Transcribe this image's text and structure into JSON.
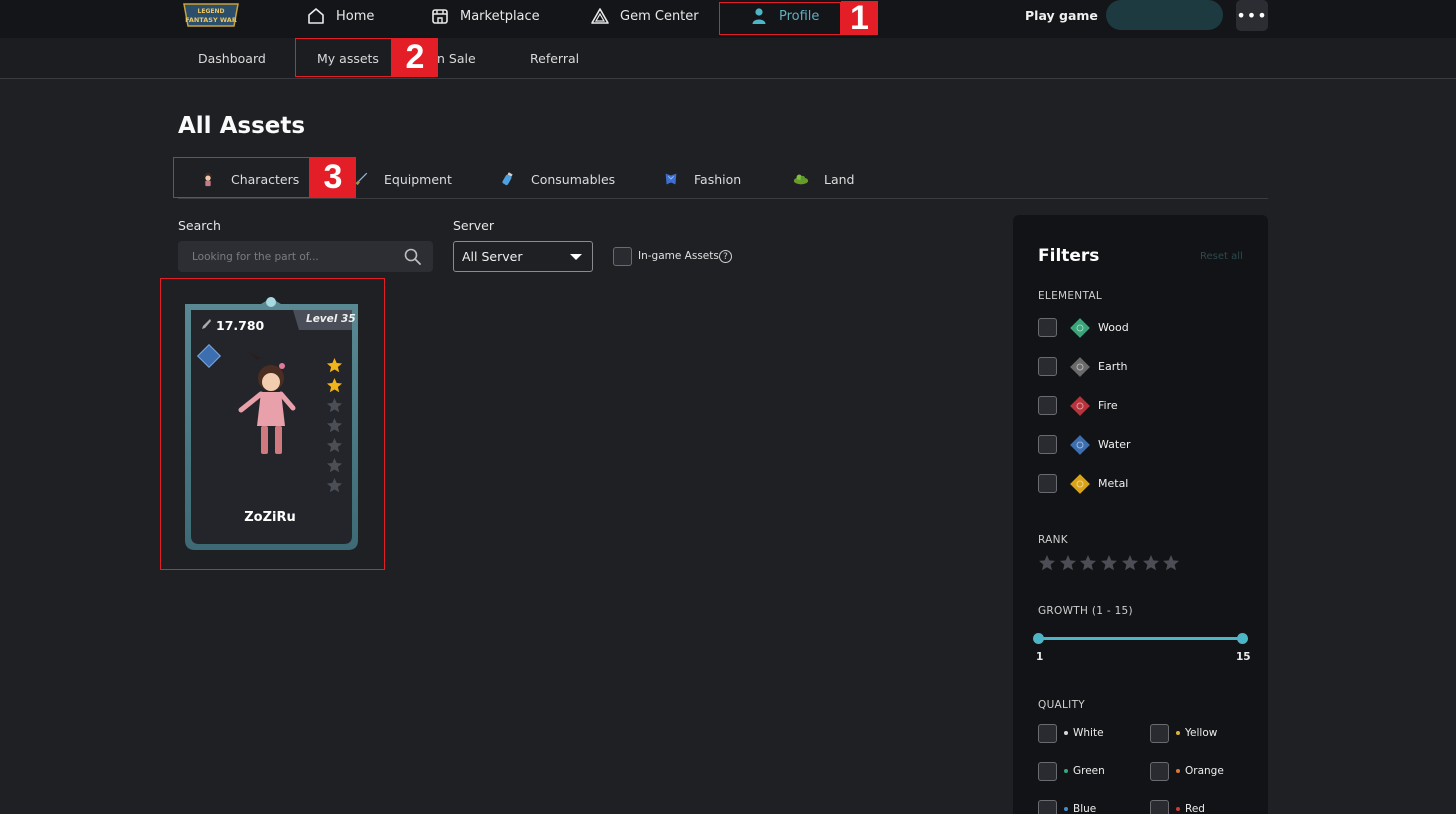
{
  "nav": {
    "logo_text_top": "LEGEND",
    "logo_text_bottom": "FANTASY WAR",
    "home": "Home",
    "marketplace": "Marketplace",
    "gem_center": "Gem Center",
    "profile": "Profile",
    "play_game": "Play game",
    "more": "•••"
  },
  "subnav": {
    "dashboard": "Dashboard",
    "my_assets": "My assets",
    "on_sale": "n Sale",
    "referral": "Referral"
  },
  "annotations": [
    "1",
    "2",
    "3"
  ],
  "page": {
    "title": "All Assets"
  },
  "tabs": [
    "Characters",
    "Equipment",
    "Consumables",
    "Fashion",
    "Land"
  ],
  "search": {
    "label": "Search",
    "placeholder": "Looking for the part of..."
  },
  "server": {
    "label": "Server",
    "selected": "All Server"
  },
  "ingame": {
    "label": "In-game Assets",
    "help": "?"
  },
  "card": {
    "power": "17.780",
    "level": "Level 35",
    "name": "ZoZiRu",
    "stars_filled": 2,
    "stars_total": 7
  },
  "filters": {
    "title": "Filters",
    "reset": "Reset all",
    "elemental_label": "ELEMENTAL",
    "elements": [
      {
        "name": "Wood",
        "color": "#3aa57a"
      },
      {
        "name": "Earth",
        "color": "#6a6a6a"
      },
      {
        "name": "Fire",
        "color": "#b8343c"
      },
      {
        "name": "Water",
        "color": "#3d6fb0"
      },
      {
        "name": "Metal",
        "color": "#d9a418"
      }
    ],
    "rank_label": "RANK",
    "rank_stars": 7,
    "growth_label": "GROWTH (1 - 15)",
    "growth_min": "1",
    "growth_max": "15",
    "quality_label": "QUALITY",
    "qualities": [
      {
        "name": "White",
        "color": "#d8d8d8"
      },
      {
        "name": "Yellow",
        "color": "#d9b43a"
      },
      {
        "name": "Green",
        "color": "#3aa57a"
      },
      {
        "name": "Orange",
        "color": "#d67a3a"
      },
      {
        "name": "Blue",
        "color": "#3d8fd0"
      },
      {
        "name": "Red",
        "color": "#d03a3a"
      }
    ]
  },
  "colors": {
    "accent": "#4db6c6",
    "annotation": "#e41e26"
  }
}
